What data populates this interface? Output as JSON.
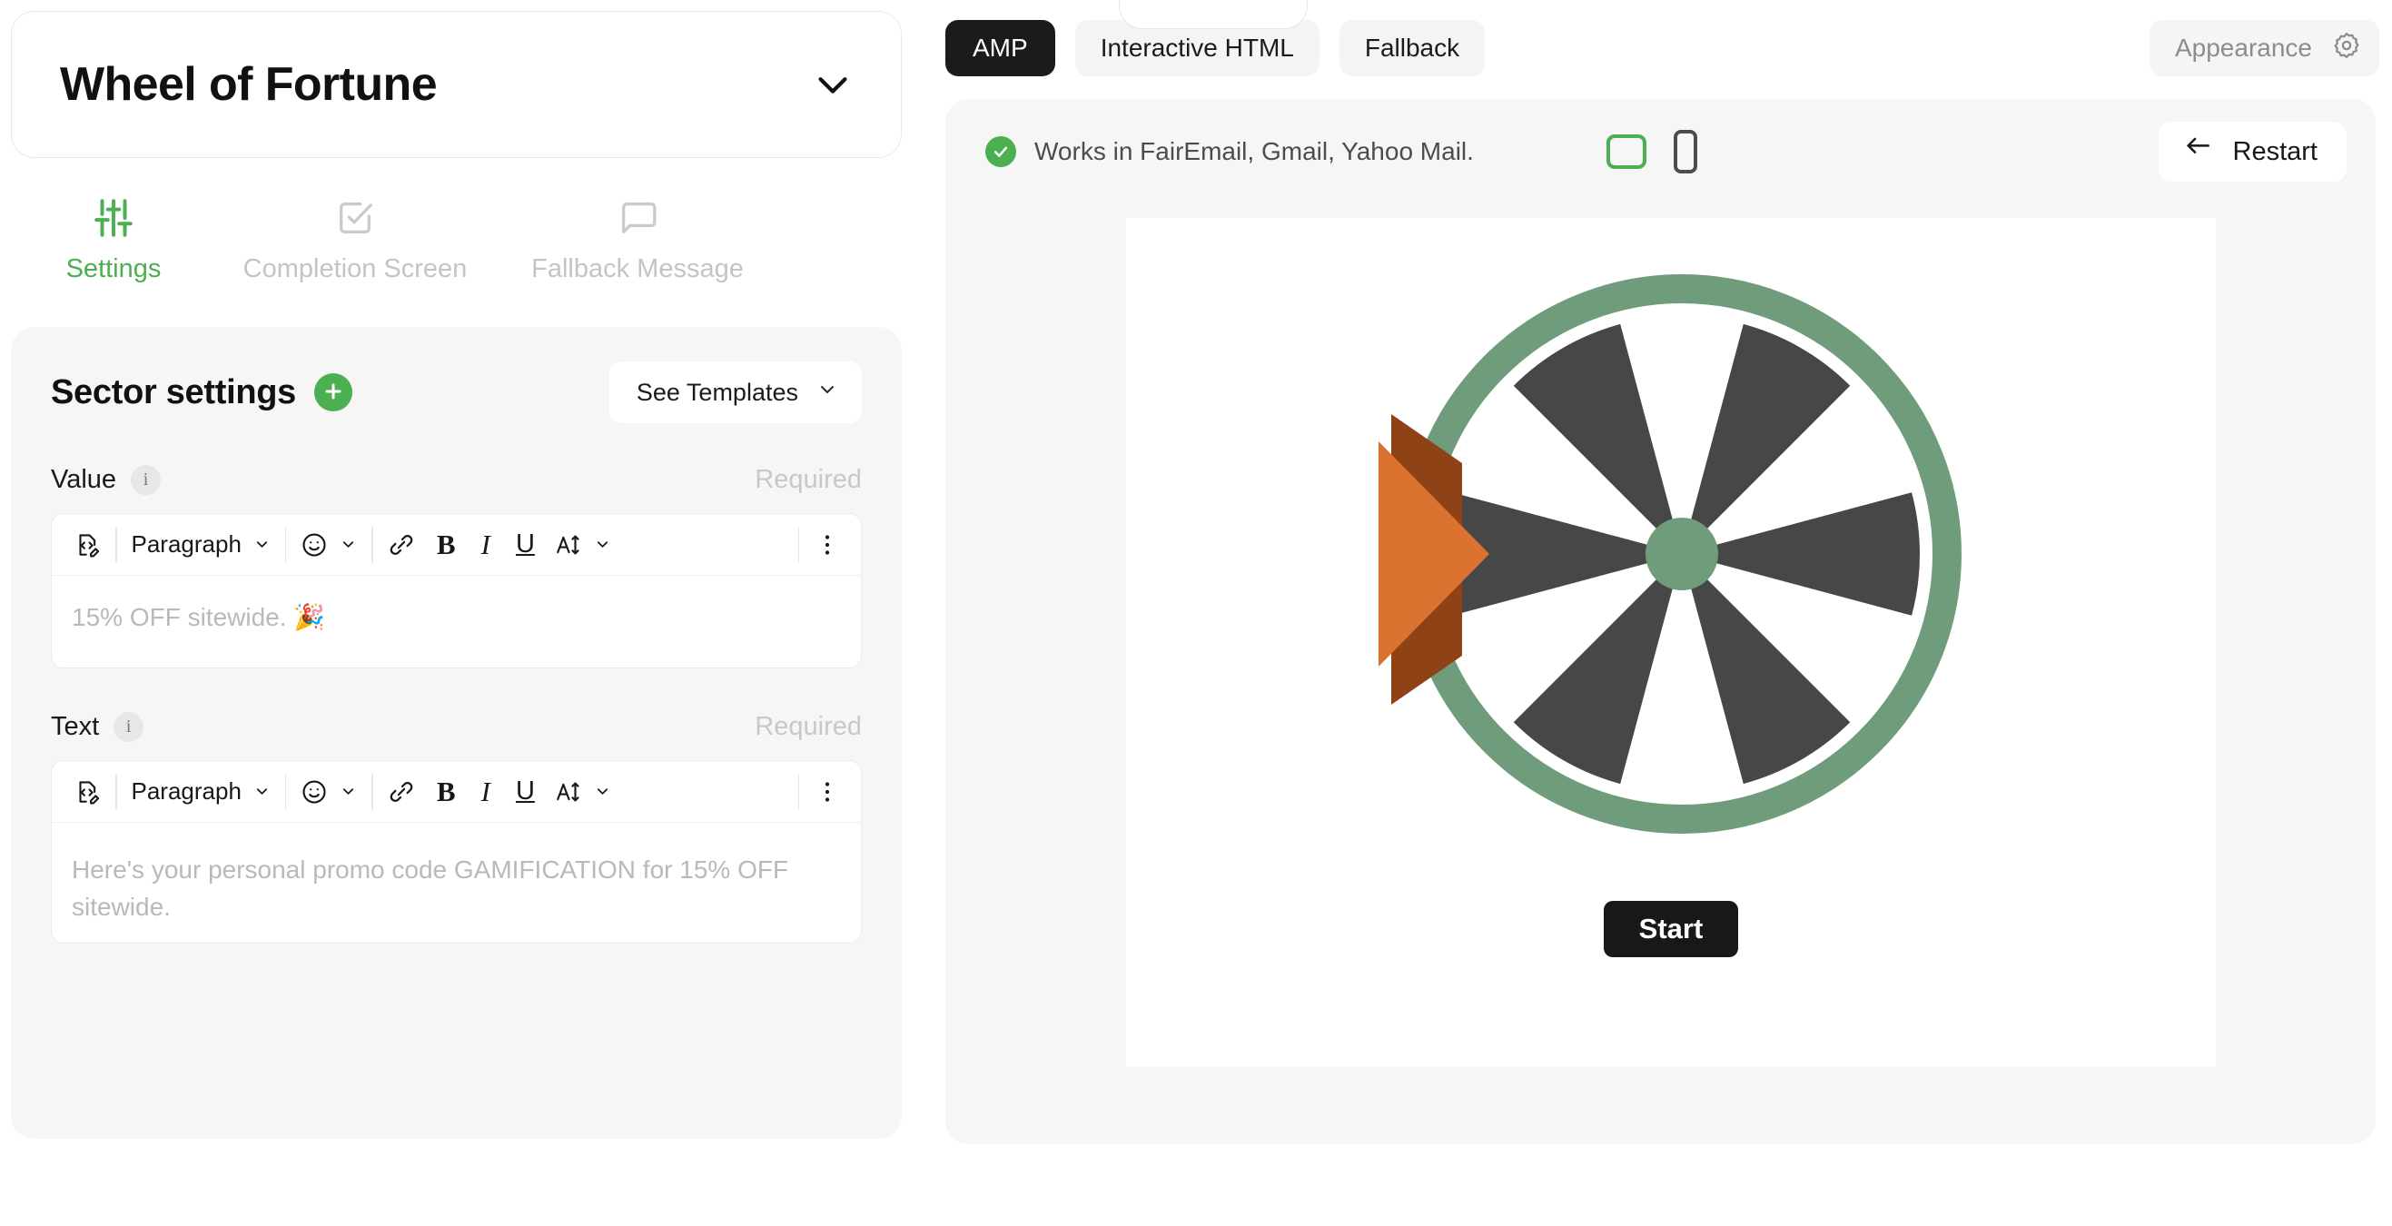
{
  "left": {
    "title": "Wheel of Fortune",
    "title_chevron_icon": "chevron-down-icon",
    "tabs": [
      {
        "label": "Settings",
        "icon": "sliders-icon",
        "active": true
      },
      {
        "label": "Completion Screen",
        "icon": "check-square-icon",
        "active": false
      },
      {
        "label": "Fallback Message",
        "icon": "speech-bubble-icon",
        "active": false
      }
    ],
    "sector": {
      "heading": "Sector settings",
      "add_icon": "plus-icon",
      "templates_label": "See Templates",
      "templates_chevron_icon": "chevron-down-icon"
    },
    "fields": [
      {
        "label": "Value",
        "info_icon": "info-icon",
        "required_label": "Required",
        "placeholder": "15% OFF sitewide. 🎉"
      },
      {
        "label": "Text",
        "info_icon": "info-icon",
        "required_label": "Required",
        "placeholder": "Here's your personal promo code GAMIFICATION for 15% OFF sitewide."
      }
    ],
    "toolbar": {
      "source_icon": "source-code-edit-icon",
      "block_label": "Paragraph",
      "block_chevron_icon": "chevron-down-icon",
      "emoji_icon": "smiley-icon",
      "emoji_chevron_icon": "chevron-down-icon",
      "link_icon": "link-icon",
      "bold_label": "B",
      "italic_label": "I",
      "underline_label": "U",
      "font_size_label": "A",
      "font_size_icon": "font-size-arrow-icon",
      "font_size_chevron_icon": "chevron-down-icon",
      "more_icon": "more-vertical-icon"
    }
  },
  "right": {
    "tabs": [
      {
        "label": "AMP",
        "active": true
      },
      {
        "label": "Interactive HTML",
        "active": false
      },
      {
        "label": "Fallback",
        "active": false
      }
    ],
    "appearance_label": "Appearance",
    "appearance_icon": "gear-icon",
    "preview": {
      "status_icon": "check-circle-icon",
      "status_text": "Works in FairEmail, Gmail, Yahoo Mail.",
      "device_desktop_icon": "desktop-icon",
      "device_mobile_icon": "mobile-icon",
      "restart_label": "Restart",
      "restart_icon": "arrow-left-icon",
      "start_label": "Start"
    }
  },
  "wheel": {
    "sector_count": 12,
    "sector_angle_deg": 30,
    "ring_color": "#6f9c7b",
    "sector_dark_color": "#474748",
    "sector_light_color": "#ffffff",
    "hub_color": "#6f9c7b",
    "pointer_color": "#db7230",
    "pointer_shadow_color": "#8f4216"
  },
  "colors": {
    "accent_green": "#4caf50",
    "panel_bg": "#f6f6f6",
    "dark": "#18181a",
    "muted": "#c3c4c6"
  }
}
